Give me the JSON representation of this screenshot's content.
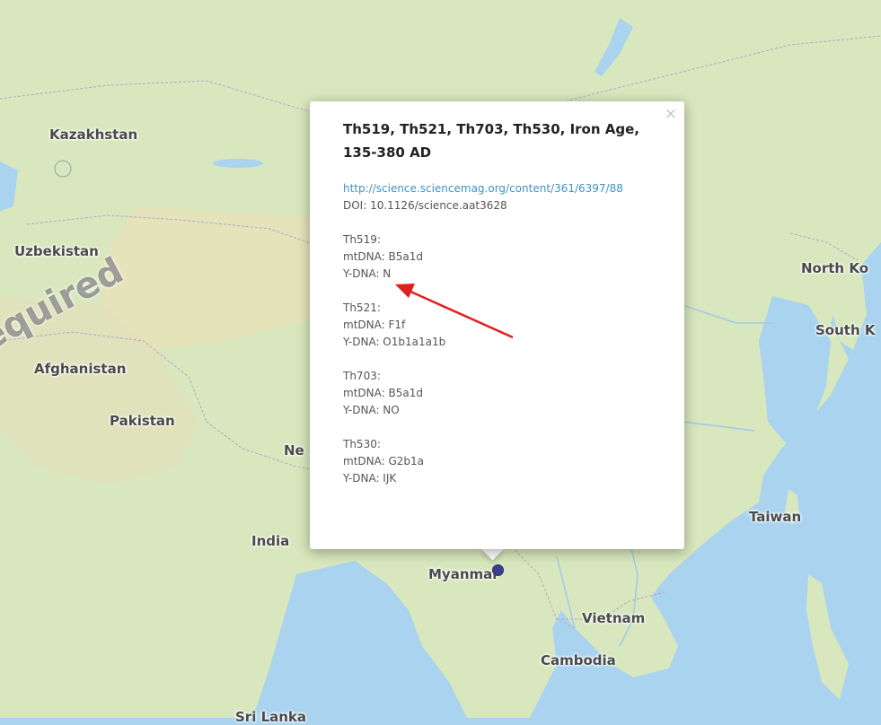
{
  "map": {
    "labels": {
      "kazakhstan": "Kazakhstan",
      "uzbekistan": "Uzbekistan",
      "afghanistan": "Afghanistan",
      "pakistan": "Pakistan",
      "nepal": "Ne",
      "india": "India",
      "myanmar": "Myanmar",
      "vietnam": "Vietnam",
      "cambodia": "Cambodia",
      "taiwan": "Taiwan",
      "north_korea": "North Ko",
      "south_korea": "South K",
      "sri_lanka": "Sri Lanka"
    },
    "watermark": "equired",
    "colors": {
      "water": "#a9d3ef",
      "land": "#d6e6bc",
      "marker": "#3c3f8c",
      "arrow": "#e02020"
    }
  },
  "popup": {
    "close_icon": "×",
    "title": "Th519, Th521, Th703, Th530, Iron Age, 135-380 AD",
    "link": "http://science.sciencemag.org/content/361/6397/88",
    "doi": "DOI: 10.1126/science.aat3628",
    "samples": [
      {
        "id": "Th519:",
        "mtdna": "mtDNA: B5a1d",
        "ydna": "Y-DNA: N"
      },
      {
        "id": "Th521:",
        "mtdna": "mtDNA: F1f",
        "ydna": "Y-DNA: O1b1a1a1b"
      },
      {
        "id": "Th703:",
        "mtdna": "mtDNA: B5a1d",
        "ydna": "Y-DNA: NO"
      },
      {
        "id": "Th530:",
        "mtdna": "mtDNA: G2b1a",
        "ydna": "Y-DNA: IJK"
      }
    ]
  }
}
